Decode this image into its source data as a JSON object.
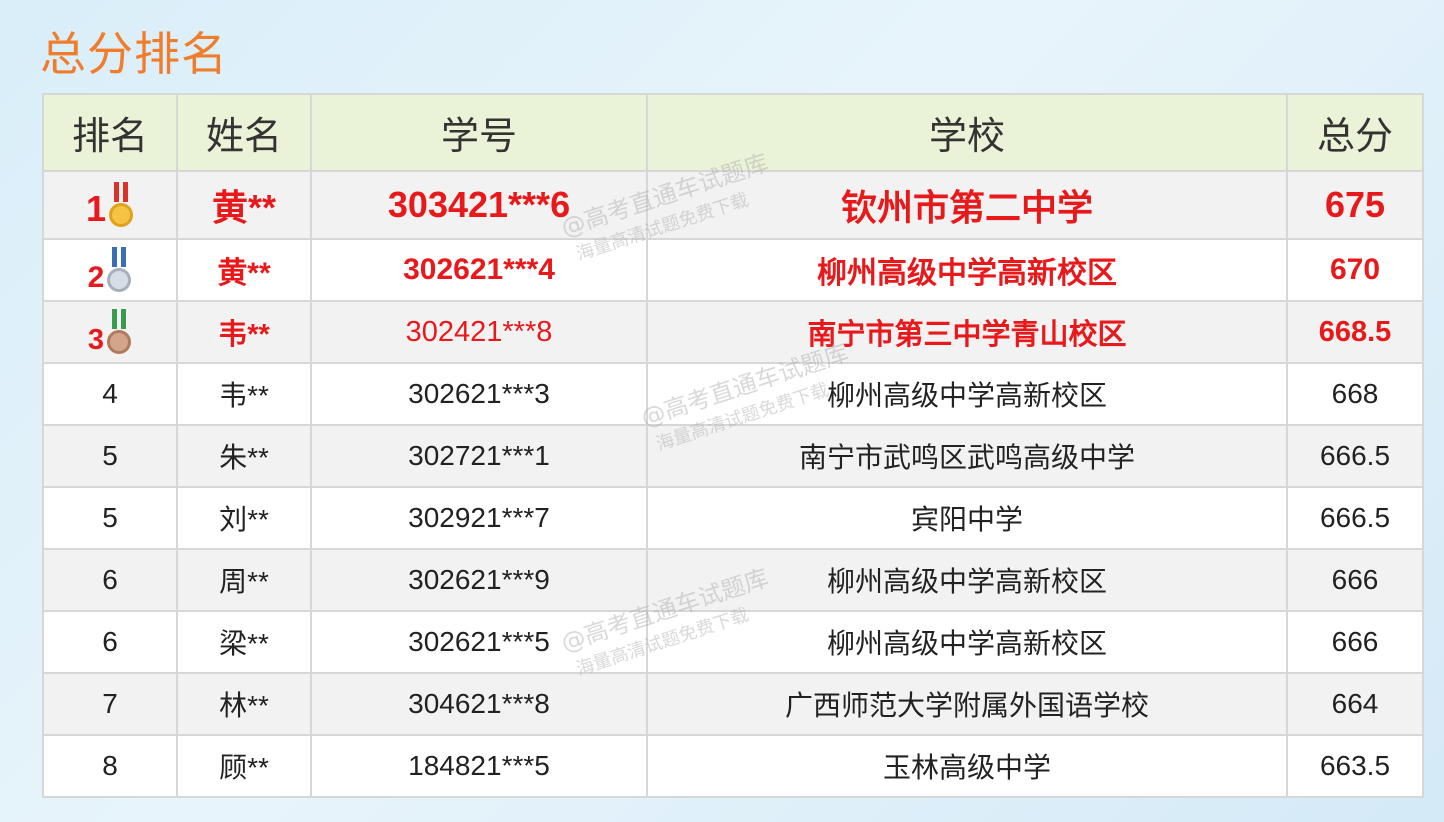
{
  "page": {
    "title": "总分排名"
  },
  "table": {
    "headers": [
      "排名",
      "姓名",
      "学号",
      "学校",
      "总分"
    ],
    "rows": [
      {
        "rank": "1",
        "name": "黄**",
        "id": "303421***6",
        "school": "钦州市第二中学",
        "score": "675",
        "medal": "gold"
      },
      {
        "rank": "2",
        "name": "黄**",
        "id": "302621***4",
        "school": "柳州高级中学高新校区",
        "score": "670",
        "medal": "silver"
      },
      {
        "rank": "3",
        "name": "韦**",
        "id": "302421***8",
        "school": "南宁市第三中学青山校区",
        "score": "668.5",
        "medal": "bronze"
      },
      {
        "rank": "4",
        "name": "韦**",
        "id": "302621***3",
        "school": "柳州高级中学高新校区",
        "score": "668"
      },
      {
        "rank": "5",
        "name": "朱**",
        "id": "302721***1",
        "school": "南宁市武鸣区武鸣高级中学",
        "score": "666.5"
      },
      {
        "rank": "5",
        "name": "刘**",
        "id": "302921***7",
        "school": "宾阳中学",
        "score": "666.5"
      },
      {
        "rank": "6",
        "name": "周**",
        "id": "302621***9",
        "school": "柳州高级中学高新校区",
        "score": "666"
      },
      {
        "rank": "6",
        "name": "梁**",
        "id": "302621***5",
        "school": "柳州高级中学高新校区",
        "score": "666"
      },
      {
        "rank": "7",
        "name": "林**",
        "id": "304621***8",
        "school": "广西师范大学附属外国语学校",
        "score": "664"
      },
      {
        "rank": "8",
        "name": "顾**",
        "id": "184821***5",
        "school": "玉林高级中学",
        "score": "663.5"
      }
    ]
  },
  "watermark": {
    "line1": "@高考直通车试题库",
    "line2": "海量高清试题免费下载"
  },
  "colors": {
    "title": "#f07d2c",
    "highlight": "#e8191b",
    "header_bg": "#eaf2d7"
  }
}
